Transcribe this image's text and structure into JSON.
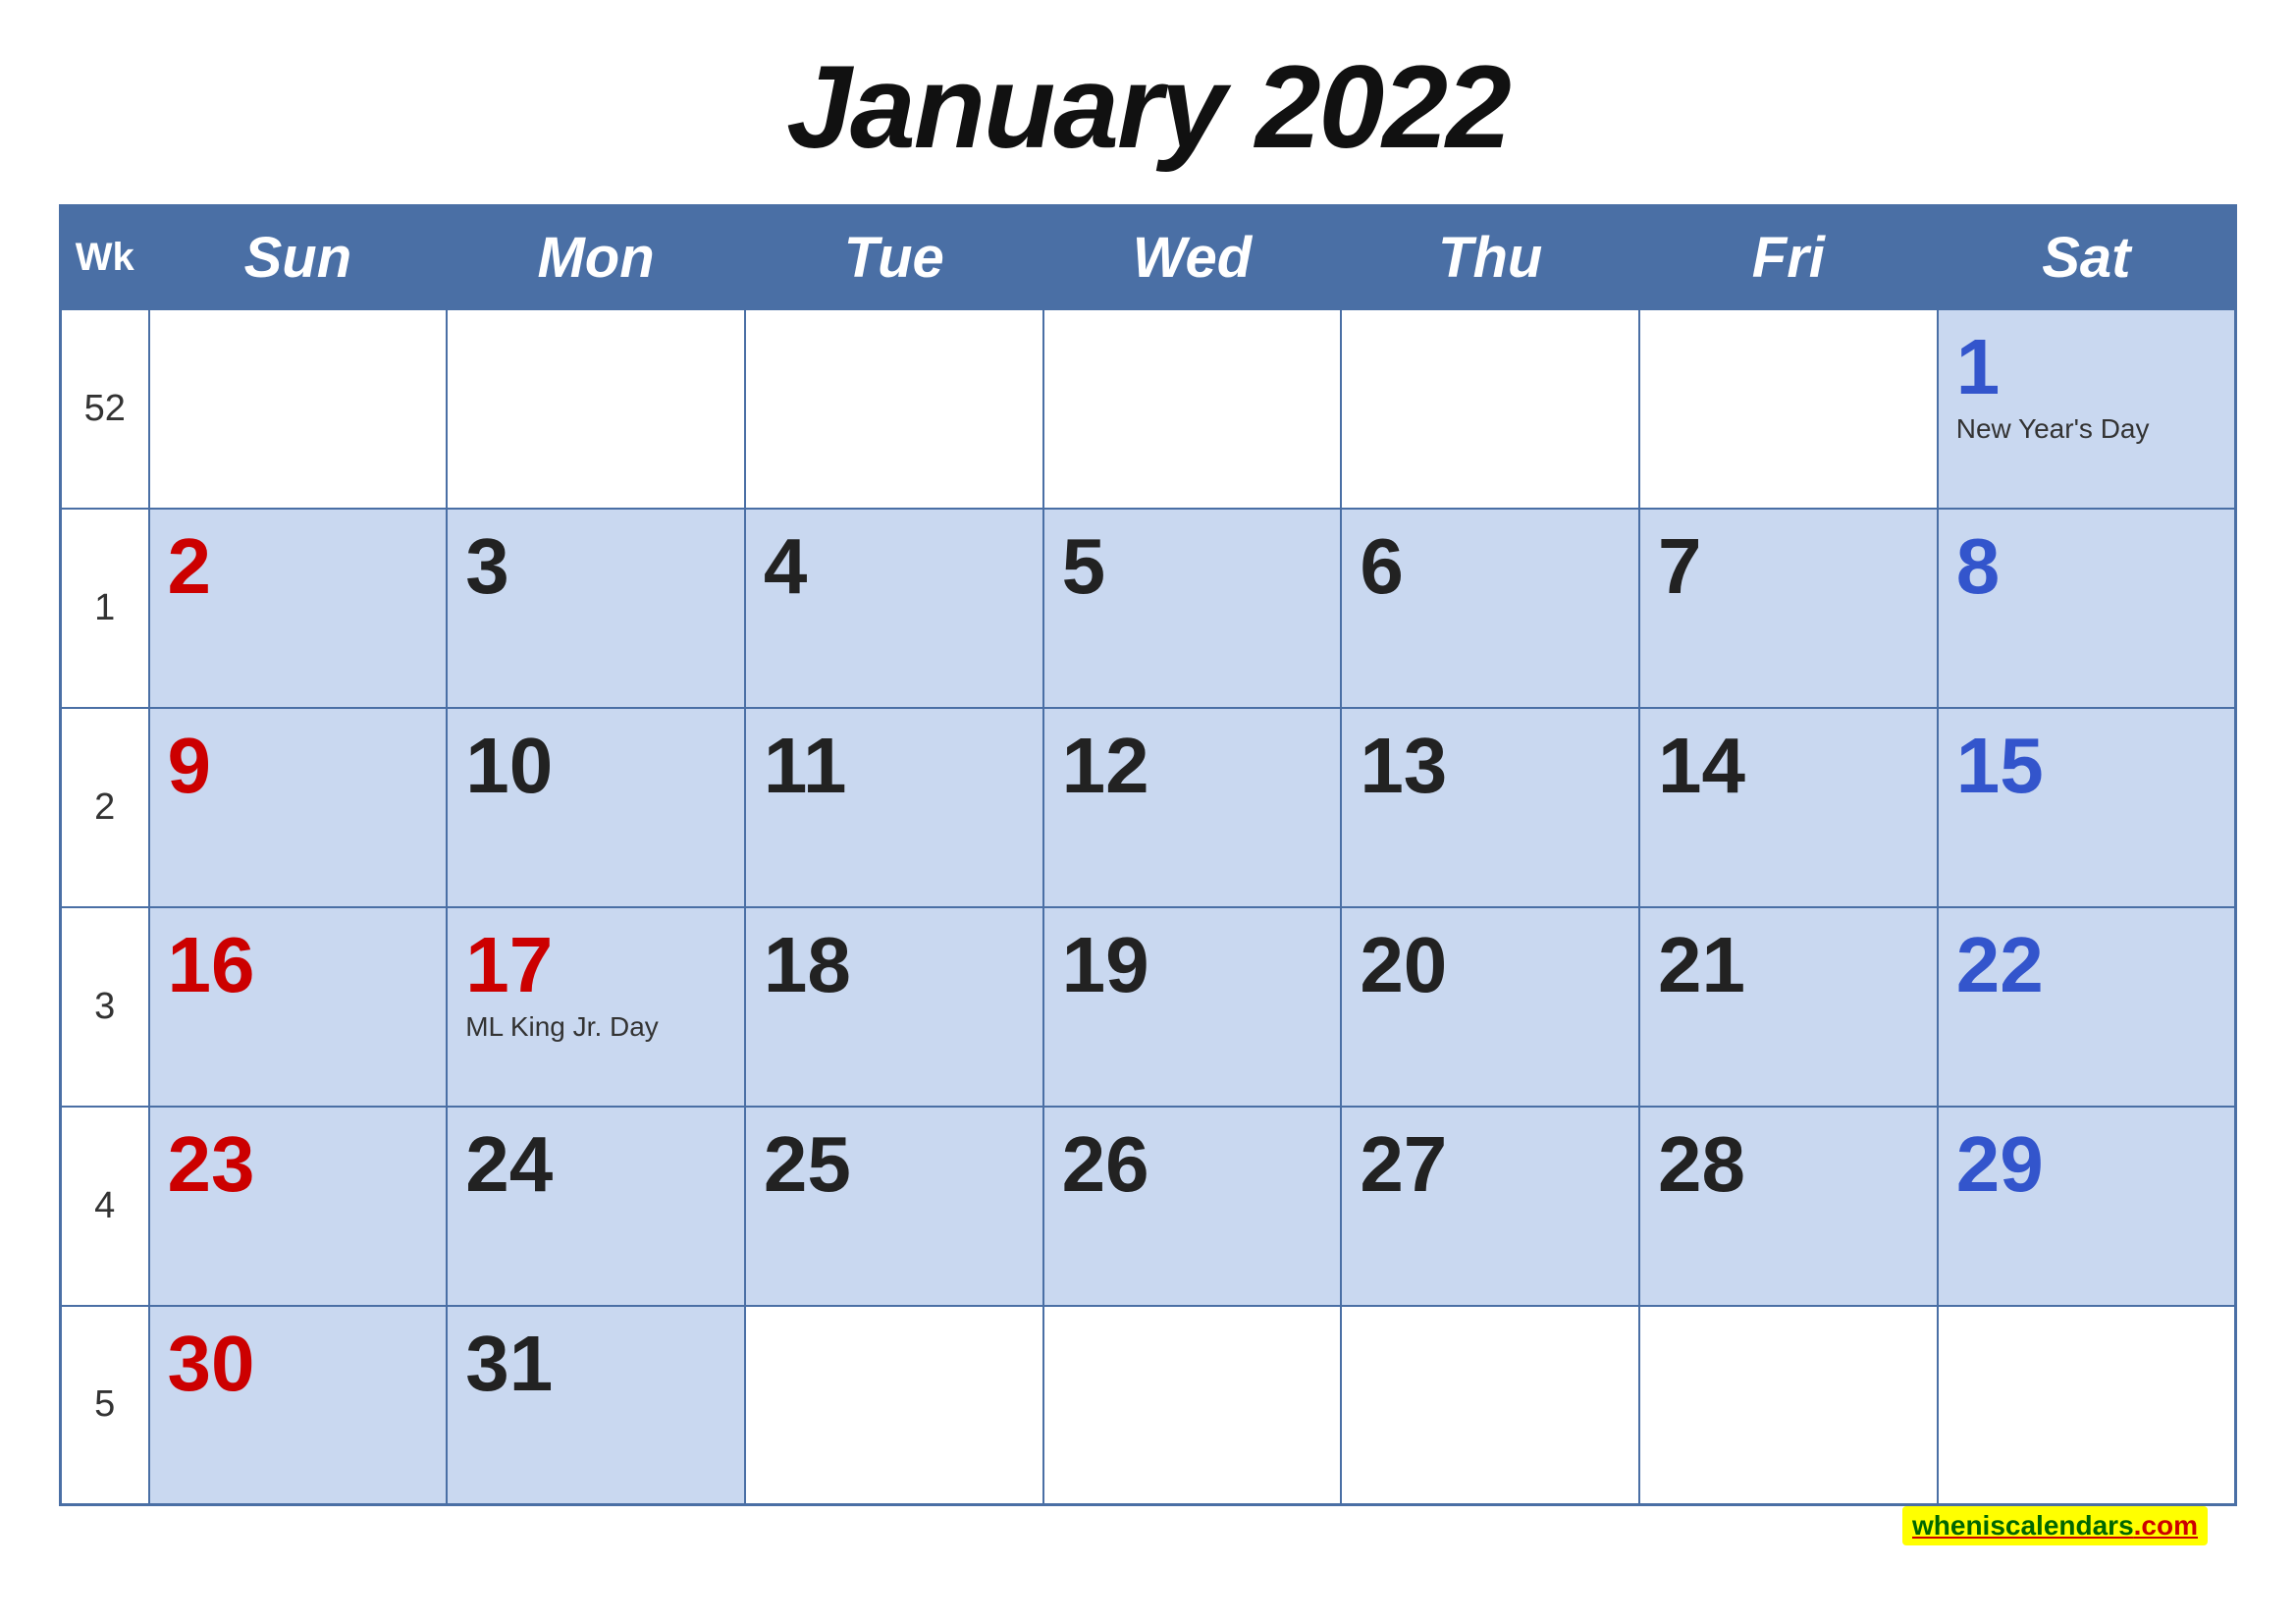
{
  "title": "January 2022",
  "header": {
    "wk_label": "Wk",
    "days": [
      "Sun",
      "Mon",
      "Tue",
      "Wed",
      "Thu",
      "Fri",
      "Sat"
    ]
  },
  "weeks": [
    {
      "wk": "52",
      "days": [
        {
          "date": "",
          "type": "empty"
        },
        {
          "date": "",
          "type": "empty"
        },
        {
          "date": "",
          "type": "empty"
        },
        {
          "date": "",
          "type": "empty"
        },
        {
          "date": "",
          "type": "empty"
        },
        {
          "date": "",
          "type": "empty"
        },
        {
          "date": "1",
          "type": "saturday",
          "holiday": "New Year's Day"
        }
      ]
    },
    {
      "wk": "1",
      "days": [
        {
          "date": "2",
          "type": "sunday"
        },
        {
          "date": "3",
          "type": "weekday"
        },
        {
          "date": "4",
          "type": "weekday"
        },
        {
          "date": "5",
          "type": "weekday"
        },
        {
          "date": "6",
          "type": "weekday"
        },
        {
          "date": "7",
          "type": "weekday"
        },
        {
          "date": "8",
          "type": "saturday"
        }
      ]
    },
    {
      "wk": "2",
      "days": [
        {
          "date": "9",
          "type": "sunday"
        },
        {
          "date": "10",
          "type": "weekday"
        },
        {
          "date": "11",
          "type": "weekday"
        },
        {
          "date": "12",
          "type": "weekday"
        },
        {
          "date": "13",
          "type": "weekday"
        },
        {
          "date": "14",
          "type": "weekday"
        },
        {
          "date": "15",
          "type": "saturday"
        }
      ]
    },
    {
      "wk": "3",
      "days": [
        {
          "date": "16",
          "type": "sunday"
        },
        {
          "date": "17",
          "type": "holiday-monday",
          "holiday": "ML King Jr. Day"
        },
        {
          "date": "18",
          "type": "weekday"
        },
        {
          "date": "19",
          "type": "weekday"
        },
        {
          "date": "20",
          "type": "weekday"
        },
        {
          "date": "21",
          "type": "weekday"
        },
        {
          "date": "22",
          "type": "saturday"
        }
      ]
    },
    {
      "wk": "4",
      "days": [
        {
          "date": "23",
          "type": "sunday"
        },
        {
          "date": "24",
          "type": "weekday"
        },
        {
          "date": "25",
          "type": "weekday"
        },
        {
          "date": "26",
          "type": "weekday"
        },
        {
          "date": "27",
          "type": "weekday"
        },
        {
          "date": "28",
          "type": "weekday"
        },
        {
          "date": "29",
          "type": "saturday"
        }
      ]
    },
    {
      "wk": "5",
      "days": [
        {
          "date": "30",
          "type": "sunday"
        },
        {
          "date": "31",
          "type": "weekday"
        },
        {
          "date": "",
          "type": "empty"
        },
        {
          "date": "",
          "type": "empty"
        },
        {
          "date": "",
          "type": "empty"
        },
        {
          "date": "",
          "type": "empty"
        },
        {
          "date": "",
          "type": "empty"
        }
      ]
    }
  ],
  "watermark": {
    "text1": "wheniscalendars",
    "text2": ".com"
  }
}
